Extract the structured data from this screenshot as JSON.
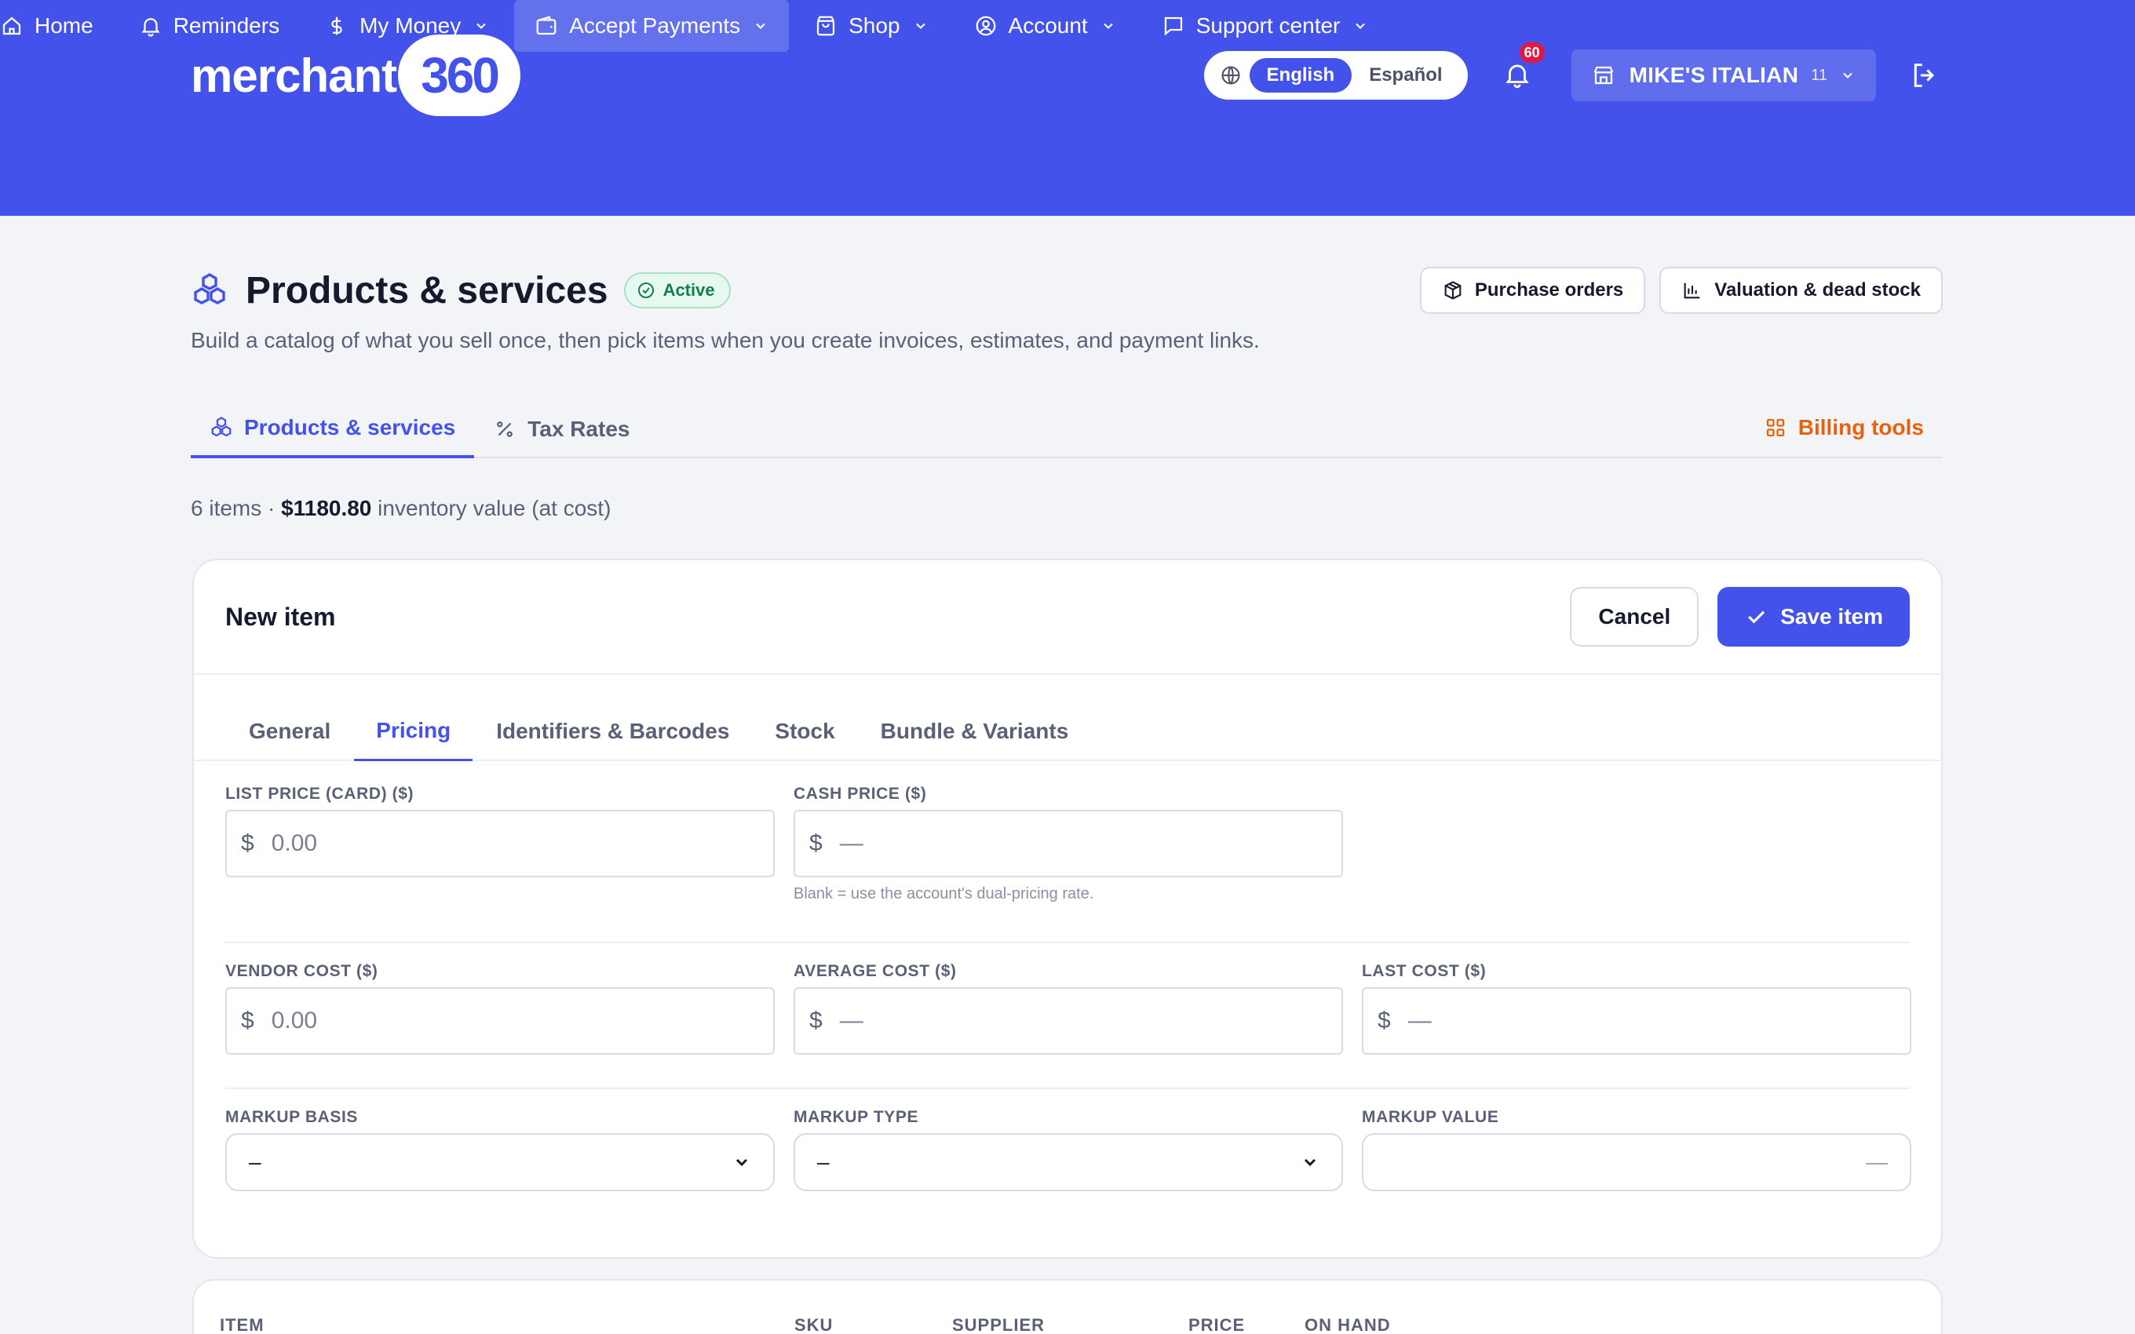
{
  "brand": {
    "name": "merchant",
    "mark": "360"
  },
  "header": {
    "languages": [
      "English",
      "Español"
    ],
    "active_language": "English",
    "notifications_count": "60",
    "merchant_name": "MIKE'S ITALIAN",
    "merchant_count": "11"
  },
  "nav": [
    {
      "label": "Home",
      "icon": "home-icon"
    },
    {
      "label": "Reminders",
      "icon": "bell-icon"
    },
    {
      "label": "My Money",
      "icon": "dollar-icon"
    },
    {
      "label": "Accept Payments",
      "icon": "wallet-icon"
    },
    {
      "label": "Shop",
      "icon": "bag-icon"
    },
    {
      "label": "Account",
      "icon": "user-circle-icon"
    },
    {
      "label": "Support center",
      "icon": "chat-icon"
    }
  ],
  "page": {
    "title": "Products & services",
    "status": "Active",
    "subtitle": "Build a catalog of what you sell once, then pick items when you create invoices, estimates, and payment links.",
    "purchase_orders": "Purchase orders",
    "valuation": "Valuation & dead stock",
    "tabs": [
      "Products & services",
      "Tax Rates"
    ],
    "billing_tools": "Billing tools",
    "summary": {
      "count": "6 items",
      "sep": "·",
      "value": "$1180.80",
      "suffix": "inventory value (at cost)"
    }
  },
  "form": {
    "title": "New item",
    "cancel": "Cancel",
    "save": "Save item",
    "tabs": [
      "General",
      "Pricing",
      "Identifiers & Barcodes",
      "Stock",
      "Bundle & Variants"
    ],
    "active_tab": "Pricing",
    "currency": "$",
    "list_price": {
      "label": "LIST PRICE (CARD) ($)",
      "placeholder": "0.00"
    },
    "cash_price": {
      "label": "CASH PRICE ($)",
      "placeholder": "—",
      "hint": "Blank = use the account's dual-pricing rate."
    },
    "vendor_cost": {
      "label": "VENDOR COST ($)",
      "placeholder": "0.00"
    },
    "average_cost": {
      "label": "AVERAGE COST ($)",
      "placeholder": "—"
    },
    "last_cost": {
      "label": "LAST COST ($)",
      "placeholder": "—"
    },
    "markup_basis": {
      "label": "MARKUP BASIS",
      "value": "–"
    },
    "markup_type": {
      "label": "MARKUP TYPE",
      "value": "–"
    },
    "markup_value": {
      "label": "MARKUP VALUE",
      "placeholder": "—"
    }
  },
  "table": {
    "columns": [
      "ITEM",
      "SKU",
      "SUPPLIER",
      "PRICE",
      "ON HAND"
    ]
  },
  "colors": {
    "brand": "#4252ea",
    "active_green": "#12804a",
    "billing_orange": "#e8620c",
    "badge_red": "#e5173e"
  }
}
